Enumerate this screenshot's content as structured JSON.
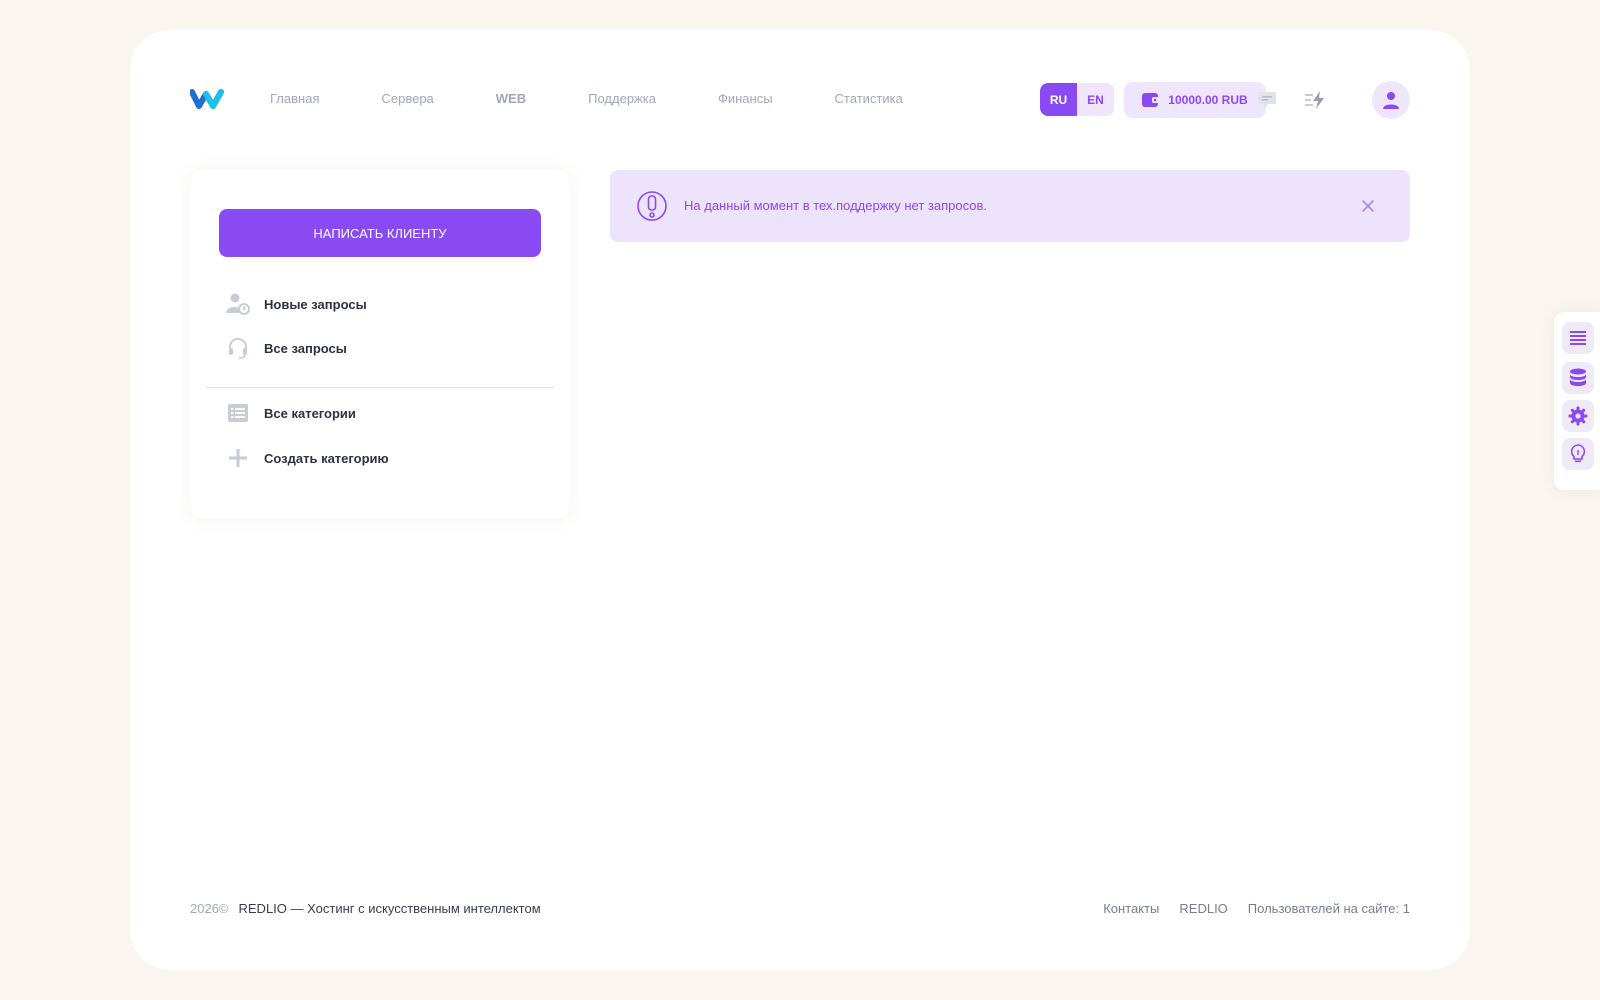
{
  "header": {
    "nav": [
      {
        "label": "Главная"
      },
      {
        "label": "Сервера"
      },
      {
        "label": "WEB"
      },
      {
        "label": "Поддержка"
      },
      {
        "label": "Финансы"
      },
      {
        "label": "Статистика"
      }
    ],
    "lang": {
      "ru": "RU",
      "en": "EN",
      "active": "RU"
    },
    "balance": "10000.00 RUB"
  },
  "sidebar": {
    "write_button": "НАПИСАТЬ КЛИЕНТУ",
    "items": [
      {
        "label": "Новые запросы",
        "icon": "user-clock-icon"
      },
      {
        "label": "Все запросы",
        "icon": "headset-icon"
      },
      {
        "label": "Все категории",
        "icon": "list-icon"
      },
      {
        "label": "Создать категорию",
        "icon": "plus-icon"
      }
    ]
  },
  "alert": {
    "text": "На данный момент в тех.поддержку нет запросов."
  },
  "footer": {
    "year": "2026©",
    "brand": "REDLIO — Хостинг с искусственным интеллектом",
    "links": [
      {
        "label": "Контакты"
      },
      {
        "label": "REDLIO"
      }
    ],
    "online": "Пользователей на сайте: 1"
  },
  "colors": {
    "accent": "#8a4af3",
    "accent_light": "#ede3fd",
    "background": "#faf6ef"
  }
}
